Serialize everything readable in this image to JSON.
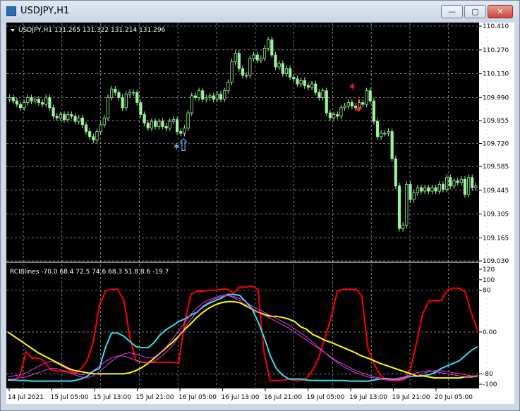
{
  "window": {
    "title": "USDJPY,H1",
    "buttons": {
      "minimize": "—",
      "maximize": "▢",
      "close": "✕"
    }
  },
  "main_chart": {
    "header": "USDJPY,H1  131.265 131.322 131.214 131.296",
    "price_labels": [
      "110.410",
      "110.270",
      "110.130",
      "109.990",
      "109.855",
      "109.720",
      "109.585",
      "109.445",
      "109.305",
      "109.165",
      "109.030"
    ]
  },
  "indicator": {
    "header": "RCI8lines -70.0 68.4 72.5 74.6 68.3 51.8 8.6 -19.7",
    "level_labels": [
      "120",
      "100",
      "80",
      "0.00",
      "-80",
      "-100"
    ]
  },
  "time_labels": [
    "14 Jul 2021",
    "15 Jul 05:00",
    "15 Jul 13:00",
    "15 Jul 21:00",
    "16 Jul 05:00",
    "16 Jul 13:00",
    "16 Jul 21:00",
    "19 Jul 05:00",
    "19 Jul 13:00",
    "19 Jul 21:00",
    "20 Jul 05:00"
  ],
  "colors": {
    "background": "#000000",
    "bull_candle": "#9ef09e",
    "grid": "#c8c8c8",
    "rci_red": "#ff0000",
    "rci_cyan": "#32e0f0",
    "rci_yellow": "#ffff00",
    "rci_magenta": "#e040e0",
    "buy_arrow": "#6ab0e8",
    "sell_arrow": "#ff2020"
  },
  "chart_data": [
    {
      "type": "candlestick",
      "title": "USDJPY,H1",
      "ylim": [
        109.03,
        110.41
      ],
      "close": [
        109.99,
        109.97,
        109.95,
        109.93,
        109.96,
        109.99,
        109.97,
        109.98,
        109.96,
        109.95,
        109.99,
        109.93,
        109.88,
        109.87,
        109.89,
        109.86,
        109.89,
        109.88,
        109.85,
        109.87,
        109.83,
        109.79,
        109.76,
        109.74,
        109.79,
        109.83,
        109.87,
        109.99,
        110.04,
        110.02,
        109.99,
        109.93,
        110.01,
        110.02,
        110.02,
        109.96,
        109.89,
        109.84,
        109.81,
        109.85,
        109.82,
        109.85,
        109.82,
        109.81,
        109.85,
        109.86,
        109.79,
        109.78,
        109.81,
        109.9,
        110.0,
        109.99,
        110.03,
        109.98,
        109.99,
        110.0,
        109.98,
        110.01,
        109.98,
        110.03,
        110.08,
        110.2,
        110.25,
        110.16,
        110.12,
        110.12,
        110.22,
        110.24,
        110.21,
        110.22,
        110.28,
        110.33,
        110.24,
        110.17,
        110.19,
        110.13,
        110.16,
        110.11,
        110.1,
        110.07,
        110.09,
        110.06,
        110.05,
        110.07,
        110.02,
        109.99,
        110.03,
        109.9,
        109.87,
        109.89,
        109.88,
        109.93,
        109.94,
        109.96,
        109.94,
        109.93,
        109.96,
        109.95,
        110.03,
        109.97,
        109.85,
        109.76,
        109.78,
        109.78,
        109.79,
        109.63,
        109.47,
        109.22,
        109.24,
        109.48,
        109.39,
        109.43,
        109.46,
        109.44,
        109.46,
        109.44,
        109.46,
        109.44,
        109.48,
        109.45,
        109.52,
        109.47,
        109.5,
        109.49,
        109.51,
        109.42,
        109.52,
        109.46,
        109.47
      ]
    },
    {
      "type": "line",
      "title": "RCI8lines -70.0 68.4 72.5 74.6 68.3 51.8 8.6 -19.7",
      "ylim": [
        -100,
        120
      ],
      "series": [
        {
          "color": "#ff0000",
          "values": [
            -93,
            -93,
            -84,
            -38,
            -50,
            -50,
            -56,
            -72,
            -75,
            -75,
            -75,
            -80,
            -70,
            -55,
            -20,
            50,
            78,
            82,
            82,
            62,
            -10,
            -55,
            -58,
            -58,
            -58,
            -58,
            -58,
            -58,
            -60,
            20,
            72,
            78,
            78,
            80,
            80,
            82,
            82,
            74,
            86,
            86,
            88,
            82,
            -40,
            -93,
            -93,
            -93,
            -90,
            -93,
            -93,
            -88,
            -72,
            -48,
            -10,
            28,
            78,
            82,
            82,
            82,
            70,
            -30,
            -60,
            -82,
            -91,
            -93,
            -93,
            -91,
            -70,
            -20,
            35,
            60,
            60,
            60,
            80,
            84,
            84,
            76,
            35,
            2
          ]
        },
        {
          "color": "#32e0f0",
          "values": [
            -92,
            -92,
            -93,
            -93,
            -94,
            -94,
            -94,
            -94,
            -94,
            -94,
            -94,
            -93,
            -90,
            -85,
            -75,
            -70,
            -30,
            -2,
            -2,
            -8,
            -18,
            -28,
            -30,
            -30,
            -20,
            -5,
            5,
            12,
            20,
            25,
            32,
            38,
            48,
            55,
            60,
            65,
            72,
            72,
            70,
            58,
            45,
            20,
            -10,
            -45,
            -70,
            -82,
            -90,
            -90,
            -90,
            -92,
            -93,
            -93,
            -93,
            -93,
            -93,
            -93,
            -94,
            -94,
            -94,
            -94,
            -92,
            -90,
            -89,
            -90,
            -91,
            -88,
            -85,
            -85,
            -84,
            -82,
            -78,
            -70,
            -65,
            -60,
            -55,
            -45,
            -35,
            -28
          ]
        },
        {
          "color": "#ffff00",
          "values": [
            0,
            -8,
            -16,
            -24,
            -32,
            -40,
            -46,
            -52,
            -58,
            -64,
            -70,
            -74,
            -76,
            -78,
            -80,
            -80,
            -80,
            -80,
            -80,
            -80,
            -78,
            -74,
            -68,
            -60,
            -50,
            -40,
            -30,
            -20,
            -8,
            5,
            16,
            28,
            38,
            46,
            52,
            56,
            58,
            58,
            56,
            50,
            44,
            38,
            34,
            30,
            30,
            28,
            25,
            20,
            10,
            5,
            -5,
            -10,
            -16,
            -20,
            -25,
            -30,
            -35,
            -40,
            -46,
            -50,
            -55,
            -60,
            -64,
            -68,
            -72,
            -76,
            -80,
            -84,
            -84,
            -86,
            -88,
            -88,
            -88,
            -88,
            -88,
            -86,
            -86,
            -84
          ]
        },
        {
          "color": "#e040e0",
          "values": [
            -86,
            -84,
            -82,
            -78,
            -72,
            -66,
            -60,
            -56,
            -60,
            -66,
            -72,
            -78,
            -82,
            -80,
            -74,
            -66,
            -56,
            -50,
            -46,
            -46,
            -50,
            -54,
            -58,
            -60,
            -56,
            -48,
            -38,
            -26,
            -10,
            8,
            24,
            38,
            50,
            58,
            64,
            68,
            70,
            66,
            60,
            52,
            44,
            38,
            32,
            26,
            20,
            14,
            8,
            0,
            -8,
            -16,
            -24,
            -32,
            -40,
            -48,
            -56,
            -62,
            -68,
            -74,
            -78,
            -82,
            -86,
            -88,
            -90,
            -90,
            -88,
            -86,
            -82,
            -78,
            -76,
            -74,
            -76,
            -78,
            -80,
            -82,
            -84,
            -86,
            -86,
            -86
          ]
        },
        {
          "color": "#e040e0",
          "values": [
            -90,
            -90,
            -88,
            -86,
            -82,
            -78,
            -74,
            -70,
            -70,
            -74,
            -78,
            -82,
            -86,
            -88,
            -84,
            -76,
            -66,
            -56,
            -48,
            -42,
            -40,
            -42,
            -46,
            -50,
            -48,
            -40,
            -28,
            -14,
            2,
            18,
            34,
            46,
            56,
            62,
            66,
            70,
            70,
            68,
            64,
            58,
            50,
            44,
            38,
            32,
            26,
            20,
            14,
            6,
            -2,
            -10,
            -20,
            -30,
            -40,
            -50,
            -58,
            -66,
            -72,
            -78,
            -82,
            -86,
            -88,
            -90,
            -92,
            -92,
            -90,
            -88,
            -86,
            -84,
            -80,
            -76,
            -74,
            -74,
            -76,
            -78,
            -80,
            -82,
            -84,
            -84
          ]
        }
      ]
    }
  ]
}
